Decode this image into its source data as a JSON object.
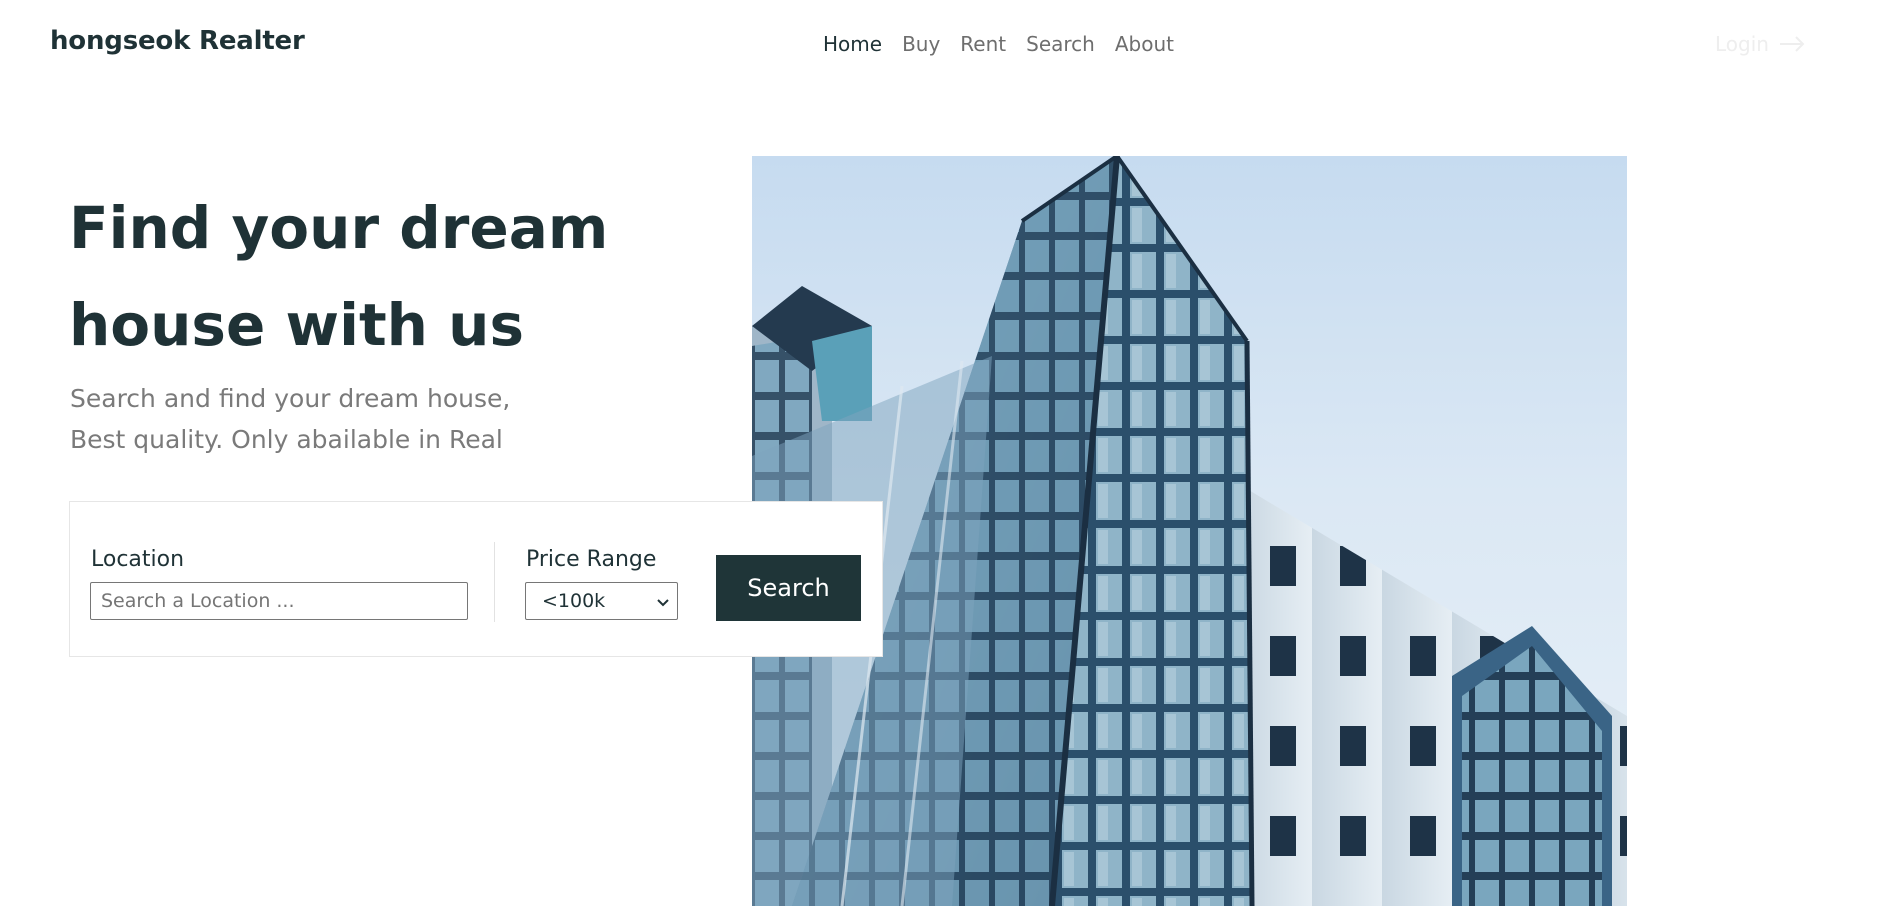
{
  "header": {
    "brand": "hongseok Realter",
    "nav": [
      {
        "label": "Home",
        "active": true
      },
      {
        "label": "Buy",
        "active": false
      },
      {
        "label": "Rent",
        "active": false
      },
      {
        "label": "Search",
        "active": false
      },
      {
        "label": "About",
        "active": false
      }
    ],
    "login_label": "Login",
    "login_icon": "arrow-right-icon"
  },
  "hero": {
    "title_line1": "Find your dream",
    "title_line2": "house with us",
    "subtitle_line1": "Search and find your dream house,",
    "subtitle_line2": "Best quality. Only abailable in Real",
    "image": "modern-apartment-building"
  },
  "search": {
    "location_label": "Location",
    "location_placeholder": "Search a Location ...",
    "location_value": "",
    "price_label": "Price Range",
    "price_selected": "<100k",
    "button_label": "Search"
  },
  "colors": {
    "primary_dark": "#1f3538",
    "text_muted": "#7a7a7a",
    "nav_muted": "#6e6e6e"
  }
}
